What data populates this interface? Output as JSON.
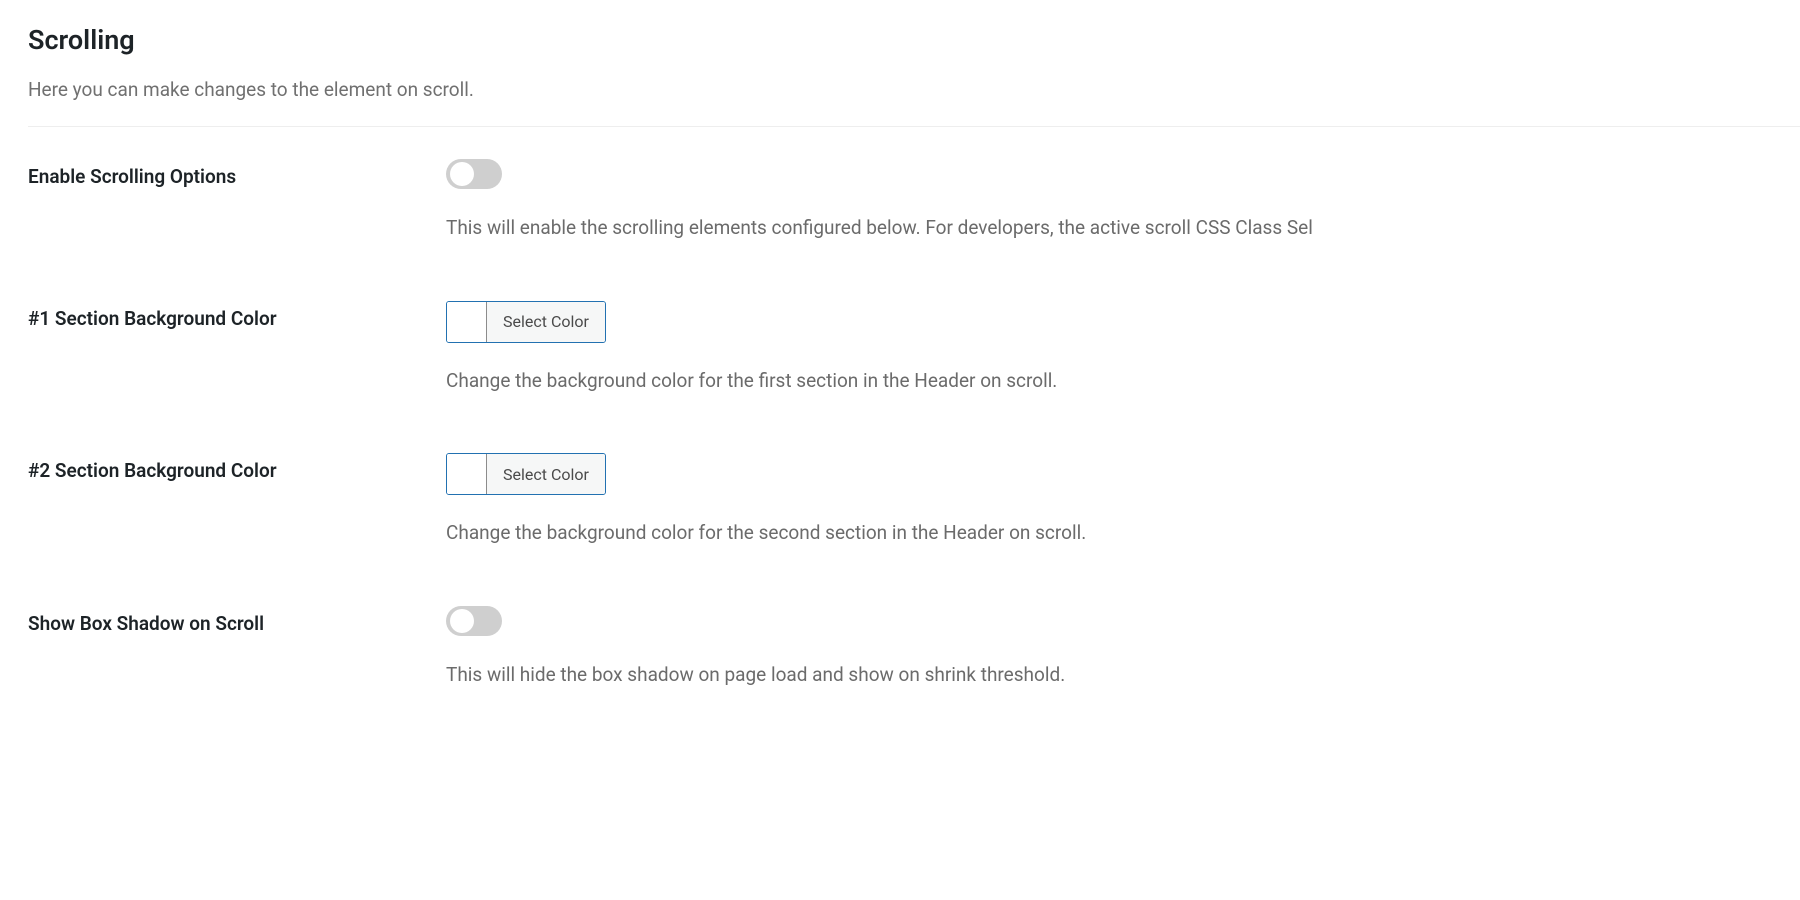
{
  "header": {
    "title": "Scrolling",
    "subtitle": "Here you can make changes to the element on scroll."
  },
  "fields": {
    "enable_scrolling": {
      "label": "Enable Scrolling Options",
      "help": "This will enable the scrolling elements configured below. For developers, the active scroll CSS Class Sel",
      "value": false
    },
    "section1_bg": {
      "label": "#1 Section Background Color",
      "button_label": "Select Color",
      "help": "Change the background color for the first section in the Header on scroll."
    },
    "section2_bg": {
      "label": "#2 Section Background Color",
      "button_label": "Select Color",
      "help": "Change the background color for the second section in the Header on scroll."
    },
    "box_shadow": {
      "label": "Show Box Shadow on Scroll",
      "help": "This will hide the box shadow on page load and show on shrink threshold.",
      "value": false
    }
  }
}
